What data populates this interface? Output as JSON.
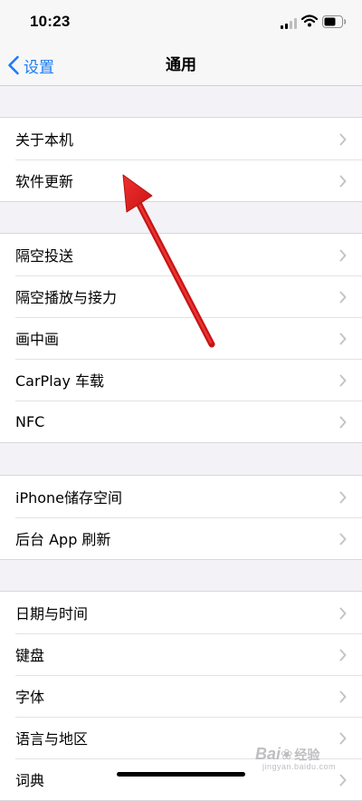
{
  "status_bar": {
    "time": "10:23"
  },
  "nav": {
    "back_label": "设置",
    "title": "通用"
  },
  "groups": [
    {
      "items": [
        {
          "label": "关于本机"
        },
        {
          "label": "软件更新"
        }
      ]
    },
    {
      "items": [
        {
          "label": "隔空投送"
        },
        {
          "label": "隔空播放与接力"
        },
        {
          "label": "画中画"
        },
        {
          "label": "CarPlay 车载"
        },
        {
          "label": "NFC"
        }
      ]
    },
    {
      "items": [
        {
          "label": "iPhone储存空间"
        },
        {
          "label": "后台 App 刷新"
        }
      ]
    },
    {
      "items": [
        {
          "label": "日期与时间"
        },
        {
          "label": "键盘"
        },
        {
          "label": "字体"
        },
        {
          "label": "语言与地区"
        },
        {
          "label": "词典"
        }
      ]
    }
  ],
  "watermark": {
    "brand": "Bai",
    "sub": "经验",
    "url": "jingyan.baidu.com"
  },
  "colors": {
    "accent": "#1b7cf5",
    "annotation": "#e01e1e",
    "background": "#f2f2f7"
  }
}
